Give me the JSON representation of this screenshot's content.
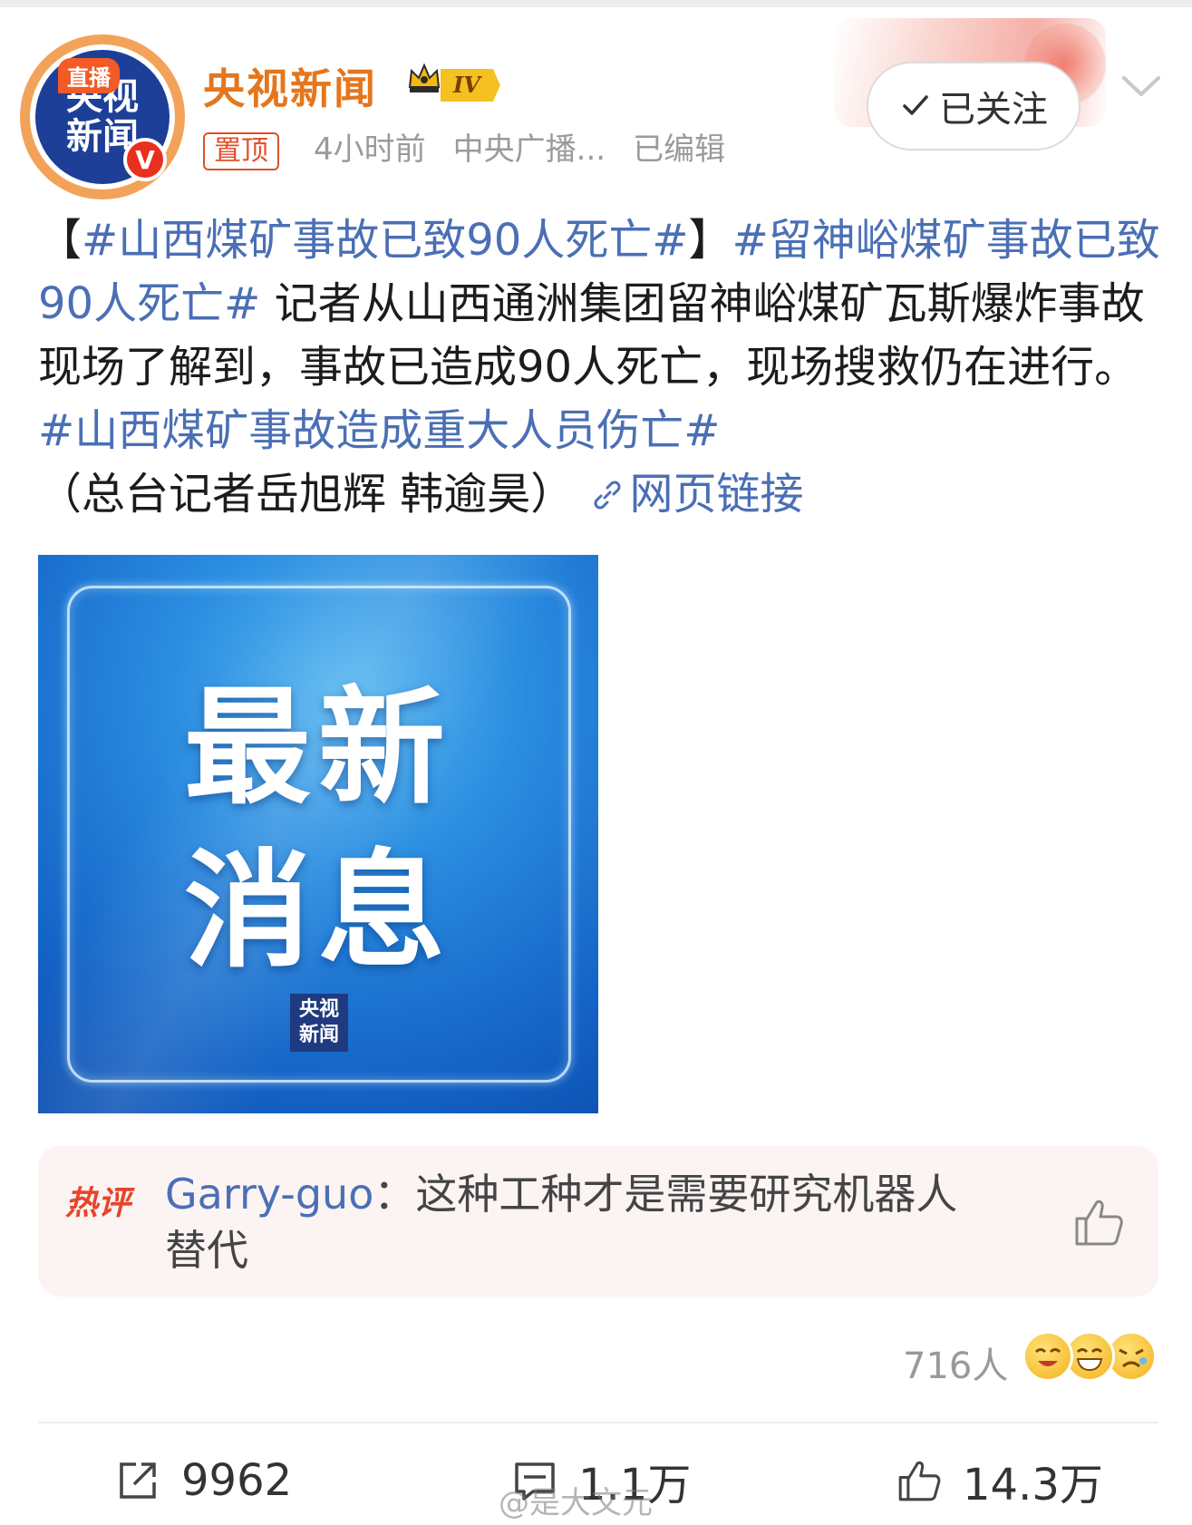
{
  "header": {
    "avatar_tag": "直播",
    "avatar_lines": [
      "央视",
      "新闻"
    ],
    "avatar_verified": "V",
    "account_name": "央视新闻",
    "level_badge": "IV",
    "pin_tag": "置顶",
    "time": "4小时前",
    "source": "中央广播...",
    "edited": "已编辑",
    "follow_label": "已关注",
    "accent_color": "#e5761c",
    "link_color": "#4a6fb5"
  },
  "post": {
    "p1": "【",
    "tag1": "#山西煤矿事故已致90人死亡#",
    "p2": "】",
    "tag2": "#留神峪煤矿事故已致90人死亡#",
    "body": " 记者从山西通洲集团留神峪煤矿瓦斯爆炸事故现场了解到，事故已造成90人死亡，现场搜救仍在进行。 ",
    "tag3": "#山西煤矿事故造成重大人员伤亡#",
    "credit": "（总台记者岳旭辉 韩逾昊）",
    "link_label": "网页链接"
  },
  "image": {
    "line1": "最新",
    "line2": "消息",
    "logo_line1": "央视",
    "logo_line2": "新闻"
  },
  "hot_comment": {
    "label": "热评",
    "user": "Garry-guo",
    "separator": "：",
    "text": "这种工种才是需要研究机器人替代"
  },
  "reactions": {
    "count": "716人"
  },
  "actions": {
    "share_count": "9962",
    "comment_count": "1.1万",
    "like_count": "14.3万"
  },
  "watermark": "@是大文元"
}
